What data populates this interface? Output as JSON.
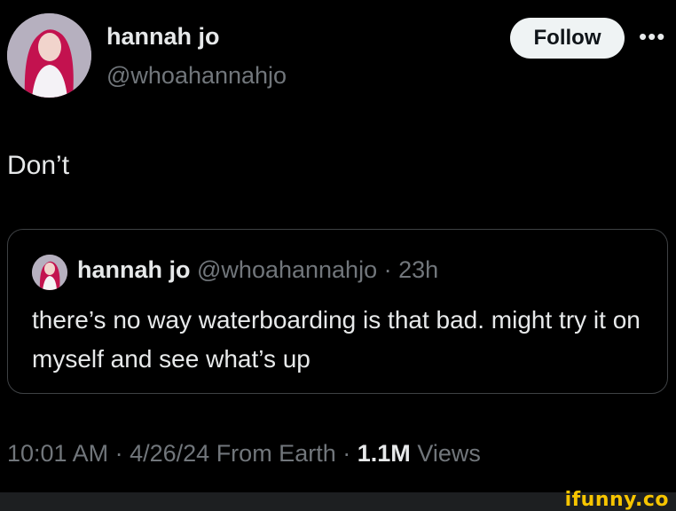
{
  "author": {
    "name": "hannah jo",
    "handle": "@whoahannahjo"
  },
  "header": {
    "follow_label": "Follow",
    "more_label": "•••"
  },
  "tweet": {
    "text": "Don’t"
  },
  "quote": {
    "name": "hannah jo",
    "handle": "@whoahannahjo",
    "separator": "·",
    "time": "23h",
    "text": "there’s no way waterboarding is that bad. might try it on myself and see what’s up"
  },
  "meta": {
    "time": "10:01 AM",
    "sep1": "·",
    "date_location": "4/26/24 From Earth",
    "sep2": "·",
    "views_count": "1.1M",
    "views_label": "Views"
  },
  "watermark": {
    "text": "ifunny.co"
  },
  "colors": {
    "background": "#000000",
    "text": "#e7e9ea",
    "muted": "#71767b",
    "watermark": "#f7c500"
  }
}
